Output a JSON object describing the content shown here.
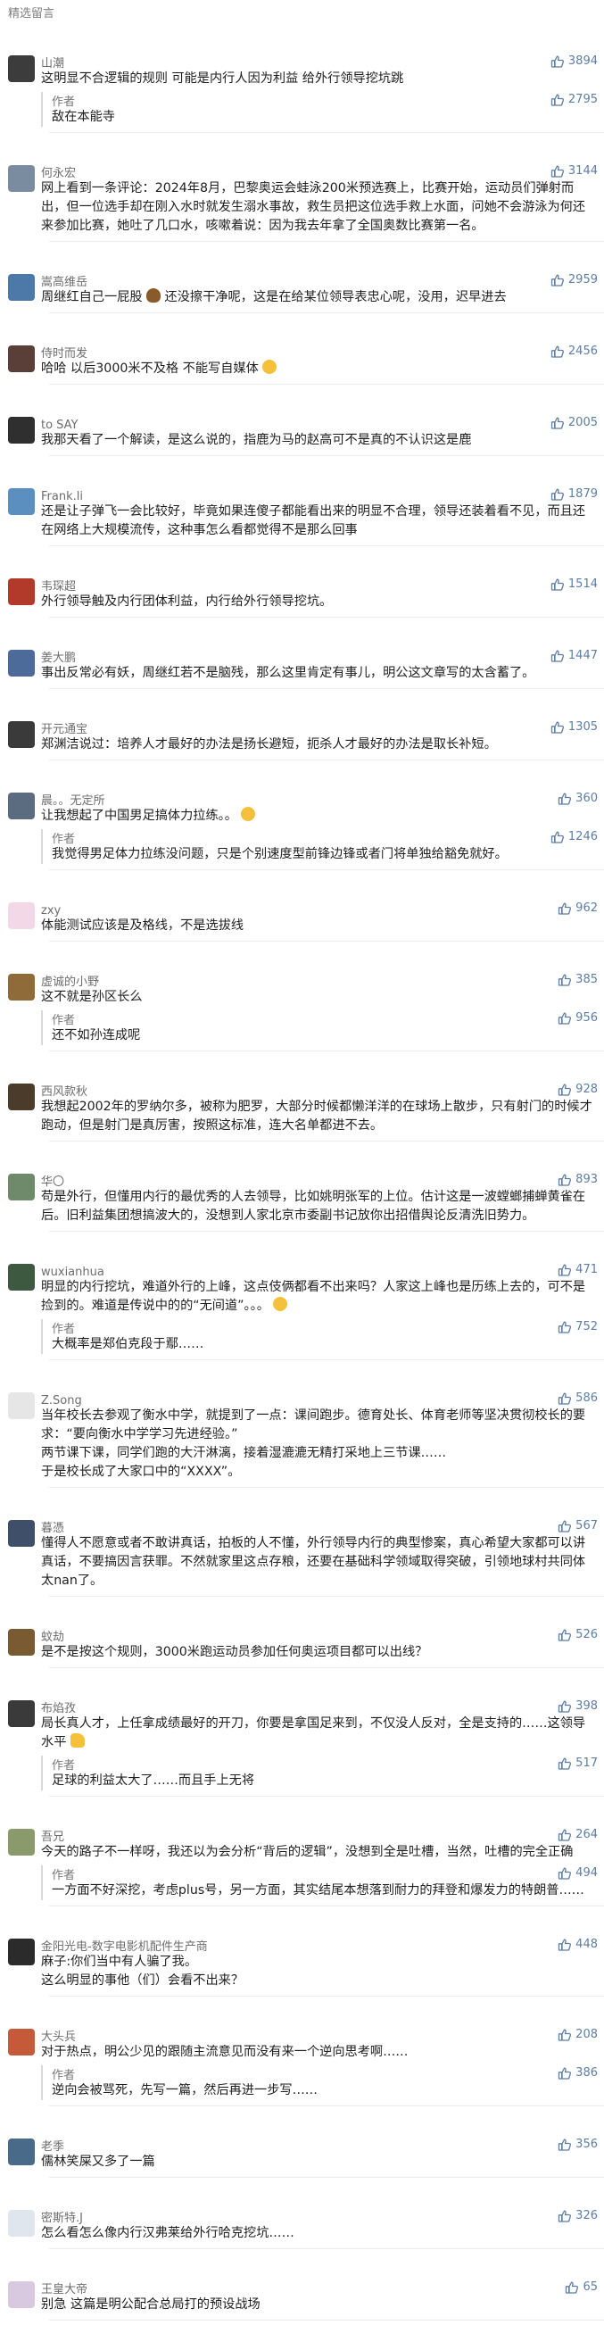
{
  "section_title": "精选留言",
  "comments": [
    {
      "id": "c1",
      "name": "山潮",
      "avatar_color": "#3c3c3c",
      "likes": "3894",
      "text": "这明显不合逻辑的规则 可能是内行人因为利益 给外行领导挖坑跳",
      "reply": {
        "author": "作者",
        "likes": "2795",
        "text": "敌在本能寺"
      }
    },
    {
      "id": "c2",
      "name": "何永宏",
      "avatar_color": "#7a8ca0",
      "likes": "3144",
      "text": "网上看到一条评论：2024年8月，巴黎奥运会蛙泳200米预选赛上，比赛开始，运动员们弹射而出，但一位选手却在刚入水时就发生溺水事故，救生员把这位选手救上水面，问她不会游泳为何还来参加比赛，她吐了几口水，咳嗽着说：因为我去年拿了全国奥数比赛第一名。"
    },
    {
      "id": "c3",
      "name": "嵩高维岳",
      "avatar_color": "#4d79a8",
      "likes": "2959",
      "text": "周继红自己一屁股",
      "emoji": "poop",
      "text2": "还没擦干净呢，这是在给某位领导表忠心呢，没用，迟早进去"
    },
    {
      "id": "c4",
      "name": "侍时而发",
      "avatar_color": "#5a3f38",
      "likes": "2456",
      "text": "哈哈  以后3000米不及格 不能写自媒体",
      "emoji_end": "face"
    },
    {
      "id": "c5",
      "name": "to SAY",
      "avatar_color": "#2f2f2f",
      "likes": "2005",
      "text": "我那天看了一个解读，是这么说的，指鹿为马的赵高可不是真的不认识这是鹿"
    },
    {
      "id": "c6",
      "name": "Frank.li",
      "avatar_color": "#5b8fbf",
      "likes": "1879",
      "text": "还是让子弹飞一会比较好，毕竟如果连傻子都能看出来的明显不合理，领导还装着看不见，而且还在网络上大规模流传，这种事怎么看都觉得不是那么回事"
    },
    {
      "id": "c7",
      "name": "韦琛超",
      "avatar_color": "#b23a2a",
      "likes": "1514",
      "text": "外行领导触及内行团体利益，内行给外行领导挖坑。"
    },
    {
      "id": "c8",
      "name": "姜大鹏",
      "avatar_color": "#4c6b9a",
      "likes": "1447",
      "text": "事出反常必有妖，周继红若不是脑残，那么这里肯定有事儿，明公这文章写的太含蓄了。"
    },
    {
      "id": "c9",
      "name": "开元通宝",
      "avatar_color": "#3a3a3a",
      "likes": "1305",
      "text": "郑渊洁说过：培养人才最好的办法是扬长避短，扼杀人才最好的办法是取长补短。"
    },
    {
      "id": "c10",
      "name": "晨。。无定所",
      "avatar_color": "#5c6c80",
      "likes": "360",
      "text": "让我想起了中国男足搞体力拉练。。",
      "emoji_end": "face",
      "reply": {
        "author": "作者",
        "likes": "1246",
        "text": "我觉得男足体力拉练没问题，只是个别速度型前锋边锋或者门将单独给豁免就好。"
      }
    },
    {
      "id": "c11",
      "name": "zxy",
      "avatar_color": "#f3d9e8",
      "likes": "962",
      "text": "体能测试应该是及格线，不是选拔线"
    },
    {
      "id": "c12",
      "name": "虚诚的小野",
      "avatar_color": "#8f6b3a",
      "likes": "385",
      "text": "这不就是孙区长么",
      "reply": {
        "author": "作者",
        "likes": "956",
        "text": "还不如孙连成呢"
      }
    },
    {
      "id": "c13",
      "name": "西风款秋",
      "avatar_color": "#4b3b2b",
      "likes": "928",
      "text": "我想起2002年的罗纳尔多，被称为肥罗，大部分时候都懒洋洋的在球场上散步，只有射门的时候才跑动，但是射门是真厉害，按照这标准，连大名单都进不去。"
    },
    {
      "id": "c14",
      "name": "华〇",
      "avatar_color": "#6f8a6a",
      "likes": "893",
      "text": "苟是外行，但懂用内行的最优秀的人去领导，比如姚明张军的上位。估计这是一波螳螂捕蝉黄雀在后。旧利益集团想搞波大的，没想到人家北京市委副书记放你出招借舆论反清洗旧势力。"
    },
    {
      "id": "c15",
      "name": "wuxianhua",
      "avatar_color": "#3d5a40",
      "likes": "471",
      "text": "明显的内行挖坑，难道外行的上峰，这点伎俩都看不出来吗？人家这上峰也是历练上去的，可不是捡到的。难道是传说中的的“无间道”。。。",
      "emoji_end": "face",
      "reply": {
        "author": "作者",
        "likes": "752",
        "text": "大概率是郑伯克段于鄢……"
      }
    },
    {
      "id": "c16",
      "name": "Z.Song",
      "avatar_color": "#e6e6e6",
      "likes": "586",
      "text": "当年校长去参观了衡水中学，就提到了一点：课间跑步。德育处长、体育老师等坚决贯彻校长的要求：“要向衡水中学学习先进经验。”\n两节课下课，同学们跑的大汗淋漓，接着湿漉漉无精打采地上三节课……\n于是校长成了大家口中的“XXXX”。"
    },
    {
      "id": "c17",
      "name": "暮憑",
      "avatar_color": "#3f4f6a",
      "likes": "567",
      "text": "懂得人不愿意或者不敢讲真话，拍板的人不懂，外行领导内行的典型惨案，真心希望大家都可以讲真话，不要搞因言获罪。不然就家里这点存粮，还要在基础科学领域取得突破，引领地球村共同体太nan了。"
    },
    {
      "id": "c18",
      "name": "蚊劫",
      "avatar_color": "#7a5a30",
      "likes": "526",
      "text": "是不是按这个规则，3000米跑运动员参加任何奥运项目都可以出线？"
    },
    {
      "id": "c19",
      "name": "布焰孜",
      "avatar_color": "#3a3a3a",
      "likes": "398",
      "text": "局长真人才，上任拿成绩最好的开刀，你要是拿国足来到，不仅没人反对，全是支持的……这领导水平",
      "emoji_end": "thumb",
      "reply": {
        "author": "作者",
        "likes": "517",
        "text": "足球的利益太大了……而且手上无将"
      }
    },
    {
      "id": "c20",
      "name": "吾兄",
      "avatar_color": "#8a9a6a",
      "likes": "264",
      "text": "今天的路子不一样呀，我还以为会分析“背后的逻辑”，没想到全是吐槽，当然，吐槽的完全正确",
      "reply": {
        "author": "作者",
        "likes": "494",
        "text": "一方面不好深挖，考虑plus号，另一方面，其实结尾本想落到耐力的拜登和爆发力的特朗普……"
      }
    },
    {
      "id": "c21",
      "name": "金阳光电-数字电影机配件生产商",
      "avatar_color": "#2b2b2b",
      "likes": "448",
      "text": "麻子:你们当中有人骗了我。\n        这么明显的事他（们）会看不出来？"
    },
    {
      "id": "c22",
      "name": "大头兵",
      "avatar_color": "#c45a3a",
      "likes": "208",
      "text": "对于热点，明公少见的跟随主流意见而没有来一个逆向思考啊……",
      "reply": {
        "author": "作者",
        "likes": "386",
        "text": "逆向会被骂死，先写一篇，然后再进一步写……"
      }
    },
    {
      "id": "c23",
      "name": "老季",
      "avatar_color": "#4a6a8a",
      "likes": "356",
      "text": "儒林笑屎又多了一篇"
    },
    {
      "id": "c24",
      "name": "密斯特.J",
      "avatar_color": "#dfe6ee",
      "likes": "326",
      "text": "怎么看怎么像内行汉弗莱给外行哈克挖坑……"
    },
    {
      "id": "c25",
      "name": "王皇大帝",
      "avatar_color": "#d8c8e0",
      "likes": "65",
      "text": "别急 这篇是明公配合总局打的预设战场"
    }
  ]
}
